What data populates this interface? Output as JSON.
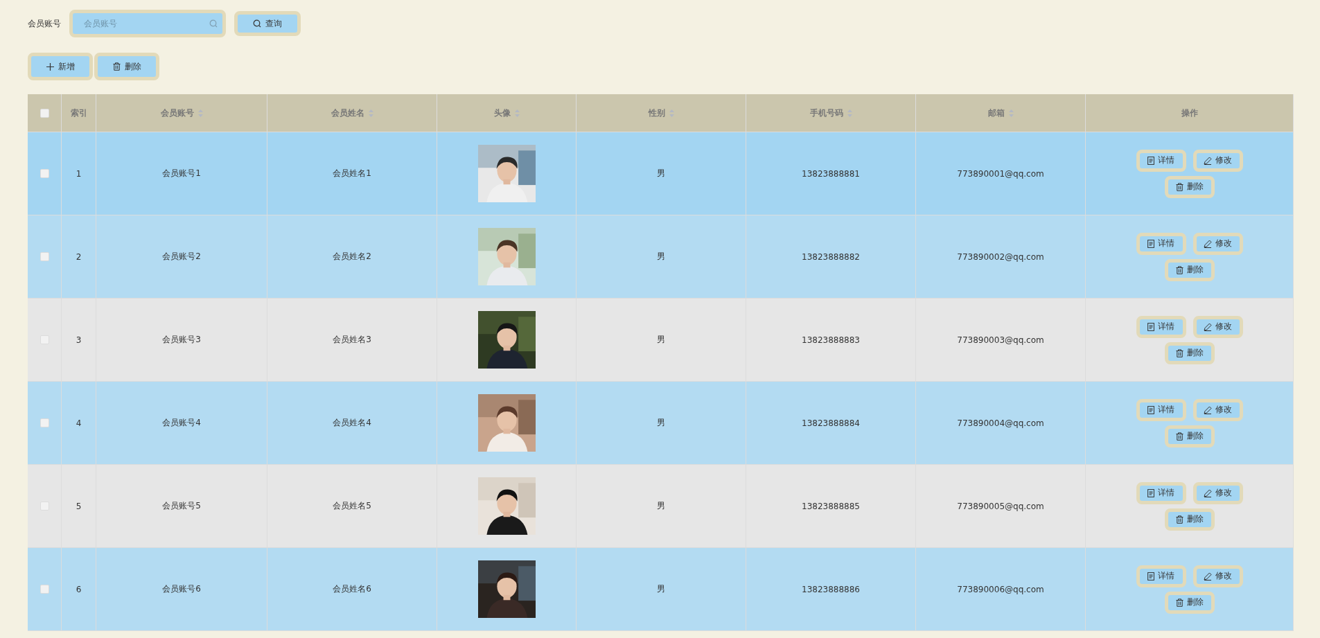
{
  "search": {
    "label": "会员账号",
    "placeholder": "会员账号",
    "button": "查询"
  },
  "toolbar": [
    {
      "kind": "add",
      "label": "新增"
    },
    {
      "kind": "delete",
      "label": "删除"
    }
  ],
  "table": {
    "header_checkbox": {
      "checked": false
    },
    "columns": [
      {
        "label": "索引",
        "sortable": false
      },
      {
        "label": "会员账号",
        "sortable": true
      },
      {
        "label": "会员姓名",
        "sortable": true
      },
      {
        "label": "头像",
        "sortable": true
      },
      {
        "label": "性别",
        "sortable": true
      },
      {
        "label": "手机号码",
        "sortable": true
      },
      {
        "label": "邮箱",
        "sortable": true
      },
      {
        "label": "操作",
        "sortable": false
      }
    ],
    "rows": [
      {
        "checked": false,
        "highlighted": true,
        "index": "1",
        "account": "会员账号1",
        "name": "会员姓名1",
        "gender": "男",
        "phone": "13823888881",
        "email": "773890001@qq.com",
        "actions": [
          {
            "kind": "detail",
            "label": "详情"
          },
          {
            "kind": "edit",
            "label": "修改"
          },
          {
            "kind": "delete",
            "label": "删除"
          }
        ]
      },
      {
        "checked": false,
        "highlighted": false,
        "index": "2",
        "account": "会员账号2",
        "name": "会员姓名2",
        "gender": "男",
        "phone": "13823888882",
        "email": "773890002@qq.com",
        "actions": [
          {
            "kind": "detail",
            "label": "详情"
          },
          {
            "kind": "edit",
            "label": "修改"
          },
          {
            "kind": "delete",
            "label": "删除"
          }
        ]
      },
      {
        "checked": false,
        "highlighted": false,
        "index": "3",
        "account": "会员账号3",
        "name": "会员姓名3",
        "gender": "男",
        "phone": "13823888883",
        "email": "773890003@qq.com",
        "actions": [
          {
            "kind": "detail",
            "label": "详情"
          },
          {
            "kind": "edit",
            "label": "修改"
          },
          {
            "kind": "delete",
            "label": "删除"
          }
        ]
      },
      {
        "checked": false,
        "highlighted": false,
        "index": "4",
        "account": "会员账号4",
        "name": "会员姓名4",
        "gender": "男",
        "phone": "13823888884",
        "email": "773890004@qq.com",
        "actions": [
          {
            "kind": "detail",
            "label": "详情"
          },
          {
            "kind": "edit",
            "label": "修改"
          },
          {
            "kind": "delete",
            "label": "删除"
          }
        ]
      },
      {
        "checked": false,
        "highlighted": false,
        "index": "5",
        "account": "会员账号5",
        "name": "会员姓名5",
        "gender": "男",
        "phone": "13823888885",
        "email": "773890005@qq.com",
        "actions": [
          {
            "kind": "detail",
            "label": "详情"
          },
          {
            "kind": "edit",
            "label": "修改"
          },
          {
            "kind": "delete",
            "label": "删除"
          }
        ]
      },
      {
        "checked": false,
        "highlighted": false,
        "index": "6",
        "account": "会员账号6",
        "name": "会员姓名6",
        "gender": "男",
        "phone": "13823888886",
        "email": "773890006@qq.com",
        "actions": [
          {
            "kind": "detail",
            "label": "详情"
          },
          {
            "kind": "edit",
            "label": "修改"
          },
          {
            "kind": "delete",
            "label": "删除"
          }
        ]
      }
    ]
  }
}
